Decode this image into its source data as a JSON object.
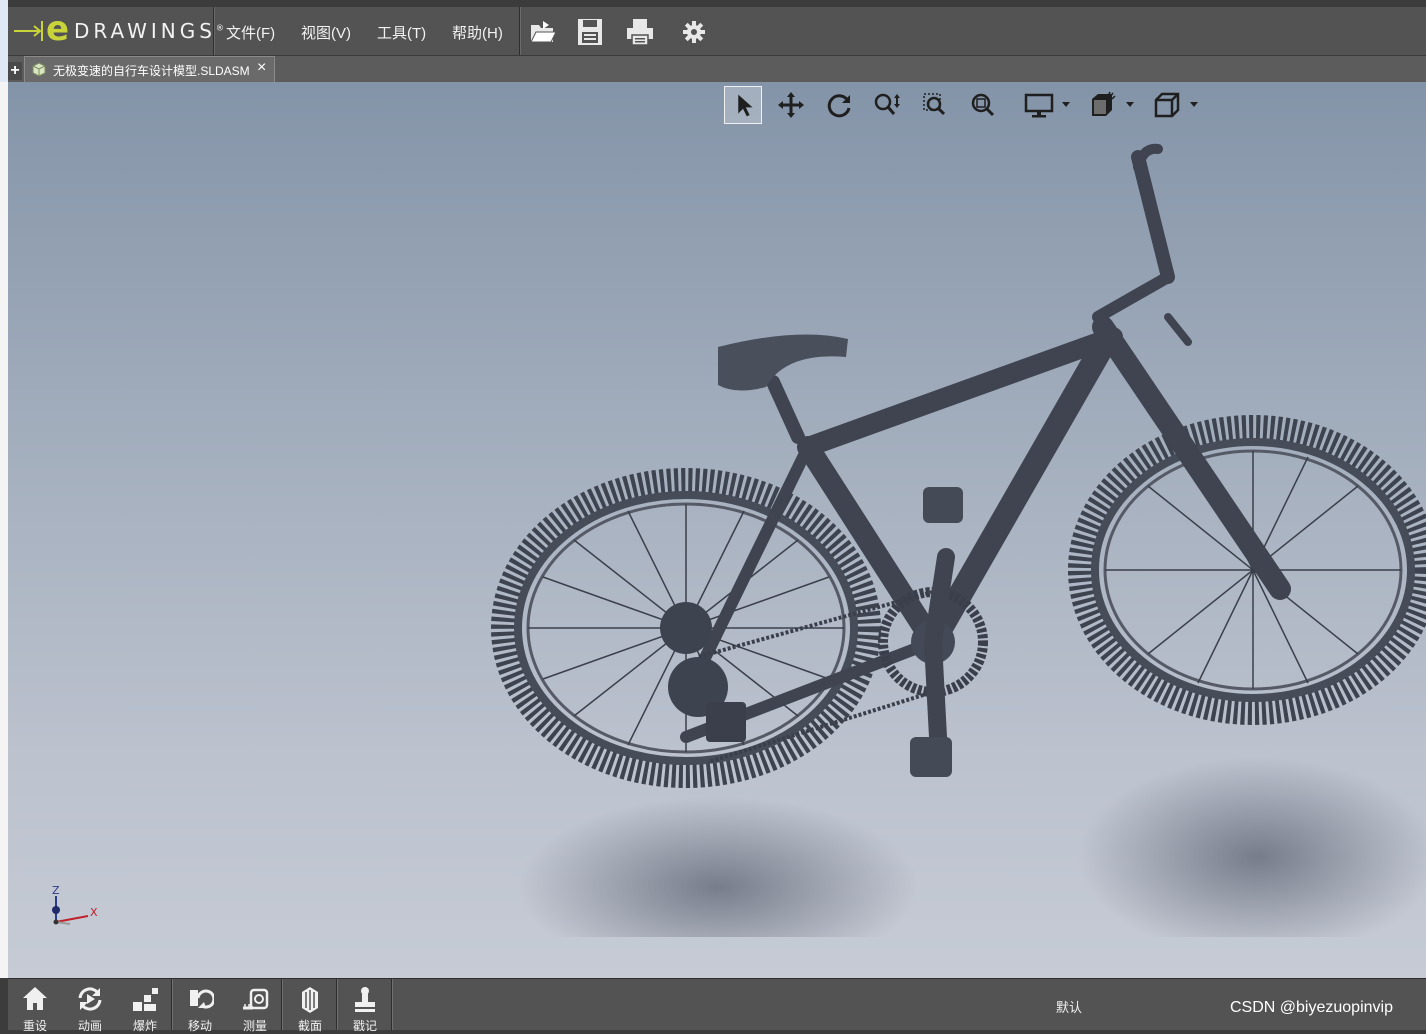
{
  "app": {
    "logo_letter": "e",
    "logo_text": "DRAWINGS",
    "logo_reg": "®",
    "accent_color": "#c9d43a"
  },
  "menu": {
    "items": [
      {
        "label": "文件(F)"
      },
      {
        "label": "视图(V)"
      },
      {
        "label": "工具(T)"
      },
      {
        "label": "帮助(H)"
      }
    ]
  },
  "toolbar": {
    "icons": [
      "open-icon",
      "save-icon",
      "print-icon",
      "settings-gear-icon"
    ]
  },
  "tabs": {
    "plus": "+",
    "items": [
      {
        "label": "无极变速的自行车设计模型.SLDASM",
        "close": "×"
      }
    ]
  },
  "view_toolbar": {
    "icons": [
      "select-arrow-icon",
      "pan-icon",
      "rotate-icon",
      "zoom-icon",
      "zoom-to-area-icon",
      "zoom-to-fit-icon",
      "display-style-icon",
      "section-views-icon",
      "standard-views-icon"
    ]
  },
  "triad": {
    "z": "Z",
    "x": "X"
  },
  "bottom_bar": {
    "buttons": [
      {
        "label": "重设",
        "icon": "home-icon"
      },
      {
        "label": "动画",
        "icon": "animate-icon"
      },
      {
        "label": "爆炸",
        "icon": "explode-icon"
      },
      {
        "label": "移动",
        "icon": "move-icon"
      },
      {
        "label": "测量",
        "icon": "measure-icon"
      },
      {
        "label": "截面",
        "icon": "section-icon"
      },
      {
        "label": "戳记",
        "icon": "stamp-icon"
      }
    ],
    "configuration": "默认",
    "watermark": "CSDN @biyezuopinvip"
  }
}
